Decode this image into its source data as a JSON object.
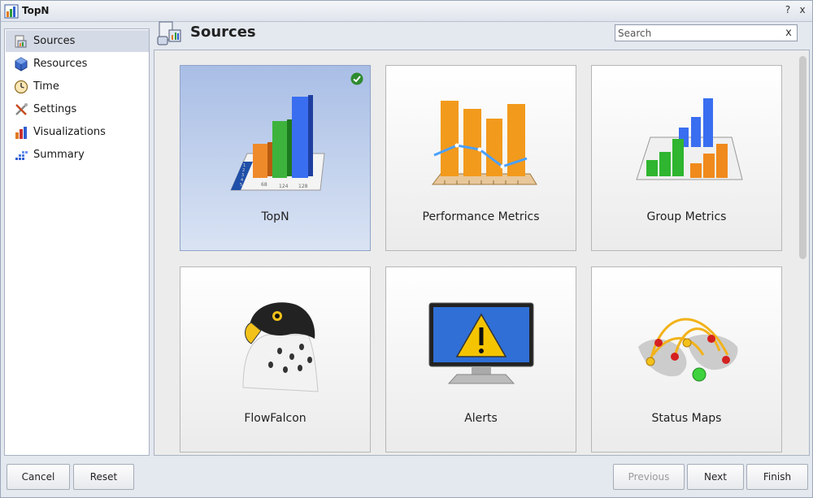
{
  "window": {
    "title": "TopN",
    "help_label": "?",
    "close_label": "x"
  },
  "sidebar": {
    "items": [
      {
        "label": "Sources",
        "icon": "sources-icon",
        "selected": true
      },
      {
        "label": "Resources",
        "icon": "resources-icon"
      },
      {
        "label": "Time",
        "icon": "clock-icon"
      },
      {
        "label": "Settings",
        "icon": "settings-tools-icon"
      },
      {
        "label": "Visualizations",
        "icon": "bar-chart-icon"
      },
      {
        "label": "Summary",
        "icon": "summary-icon"
      }
    ]
  },
  "header": {
    "title": "Sources",
    "search": {
      "placeholder": "Search",
      "value": "",
      "clear_label": "x"
    }
  },
  "tiles": [
    {
      "label": "TopN",
      "icon": "topn-chart-icon",
      "selected": true,
      "check_icon": "check-icon"
    },
    {
      "label": "Performance Metrics",
      "icon": "performance-metrics-icon"
    },
    {
      "label": "Group Metrics",
      "icon": "group-metrics-icon"
    },
    {
      "label": "FlowFalcon",
      "icon": "falcon-icon"
    },
    {
      "label": "Alerts",
      "icon": "alert-monitor-icon"
    },
    {
      "label": "Status Maps",
      "icon": "world-map-icon"
    }
  ],
  "footer": {
    "cancel": "Cancel",
    "reset": "Reset",
    "previous": "Previous",
    "next": "Next",
    "finish": "Finish"
  },
  "colors": {
    "selected_tile": "#a9bee6",
    "sidebar_selected": "#d5dbe6",
    "check": "#2e8b2e"
  }
}
